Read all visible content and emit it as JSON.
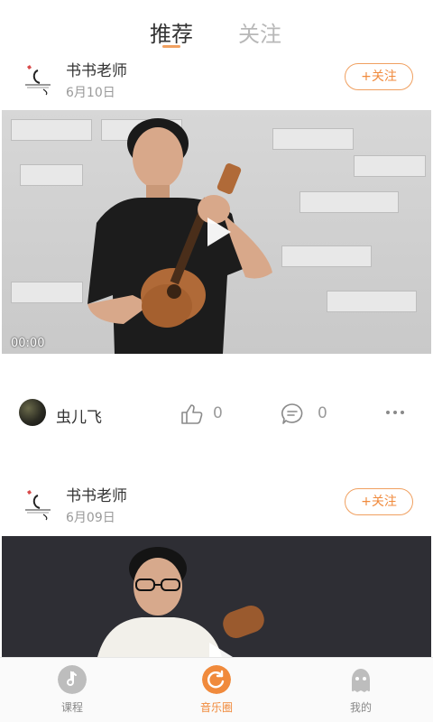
{
  "top_tabs": [
    {
      "label": "推荐"
    },
    {
      "label": "关注"
    }
  ],
  "posts": [
    {
      "author": "书书老师",
      "date": "6月10日",
      "follow_label": "+关注",
      "video_time": "00:00",
      "user_name": "虫儿飞",
      "likes": "0",
      "comments": "0"
    },
    {
      "author": "书书老师",
      "date": "6月09日",
      "follow_label": "+关注"
    }
  ],
  "bottom_nav": [
    {
      "label": "课程",
      "icon": "music-note-icon"
    },
    {
      "label": "音乐圈",
      "icon": "refresh-circle-icon"
    },
    {
      "label": "我的",
      "icon": "ghost-profile-icon"
    }
  ],
  "colors": {
    "accent": "#f08a3c",
    "inactive_tab": "#b8b8b8"
  }
}
